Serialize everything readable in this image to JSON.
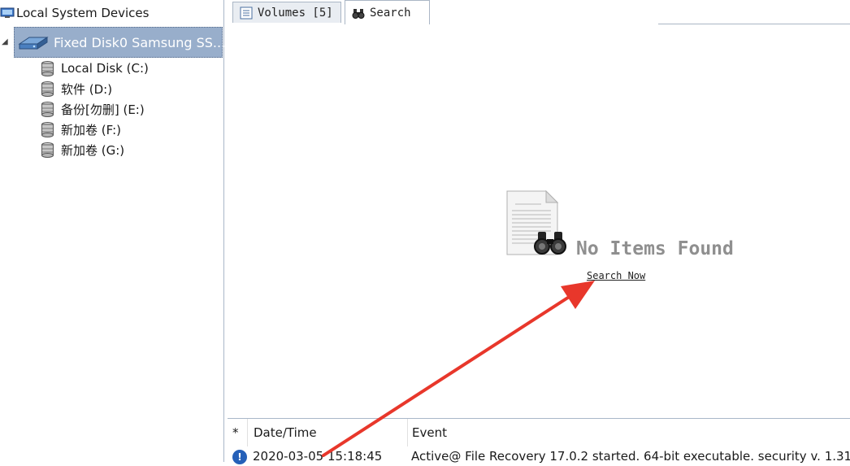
{
  "tree": {
    "root_label": "Local System Devices",
    "disk_label": "Fixed Disk0 Samsung SS...",
    "volumes": [
      {
        "label": "Local Disk (C:)"
      },
      {
        "label": "软件 (D:)"
      },
      {
        "label": "备份[勿删] (E:)"
      },
      {
        "label": "新加卷 (F:)"
      },
      {
        "label": "新加卷 (G:)"
      }
    ]
  },
  "tabs": [
    {
      "label": "Volumes [5]",
      "icon": "volumes-list-icon"
    },
    {
      "label": "Search",
      "icon": "binoculars-icon",
      "active": true
    }
  ],
  "search_panel": {
    "empty_message": "No Items Found",
    "search_now_link": "Search Now"
  },
  "log": {
    "columns": [
      "*",
      "Date/Time",
      "Event"
    ],
    "rows": [
      {
        "icon": "info-icon",
        "datetime": "2020-03-05 15:18:45",
        "event": "Active@ File Recovery 17.0.2 started. 64-bit executable. security v. 1.31"
      }
    ]
  },
  "annotation": {
    "type": "red-arrow",
    "color": "#e8372b"
  }
}
